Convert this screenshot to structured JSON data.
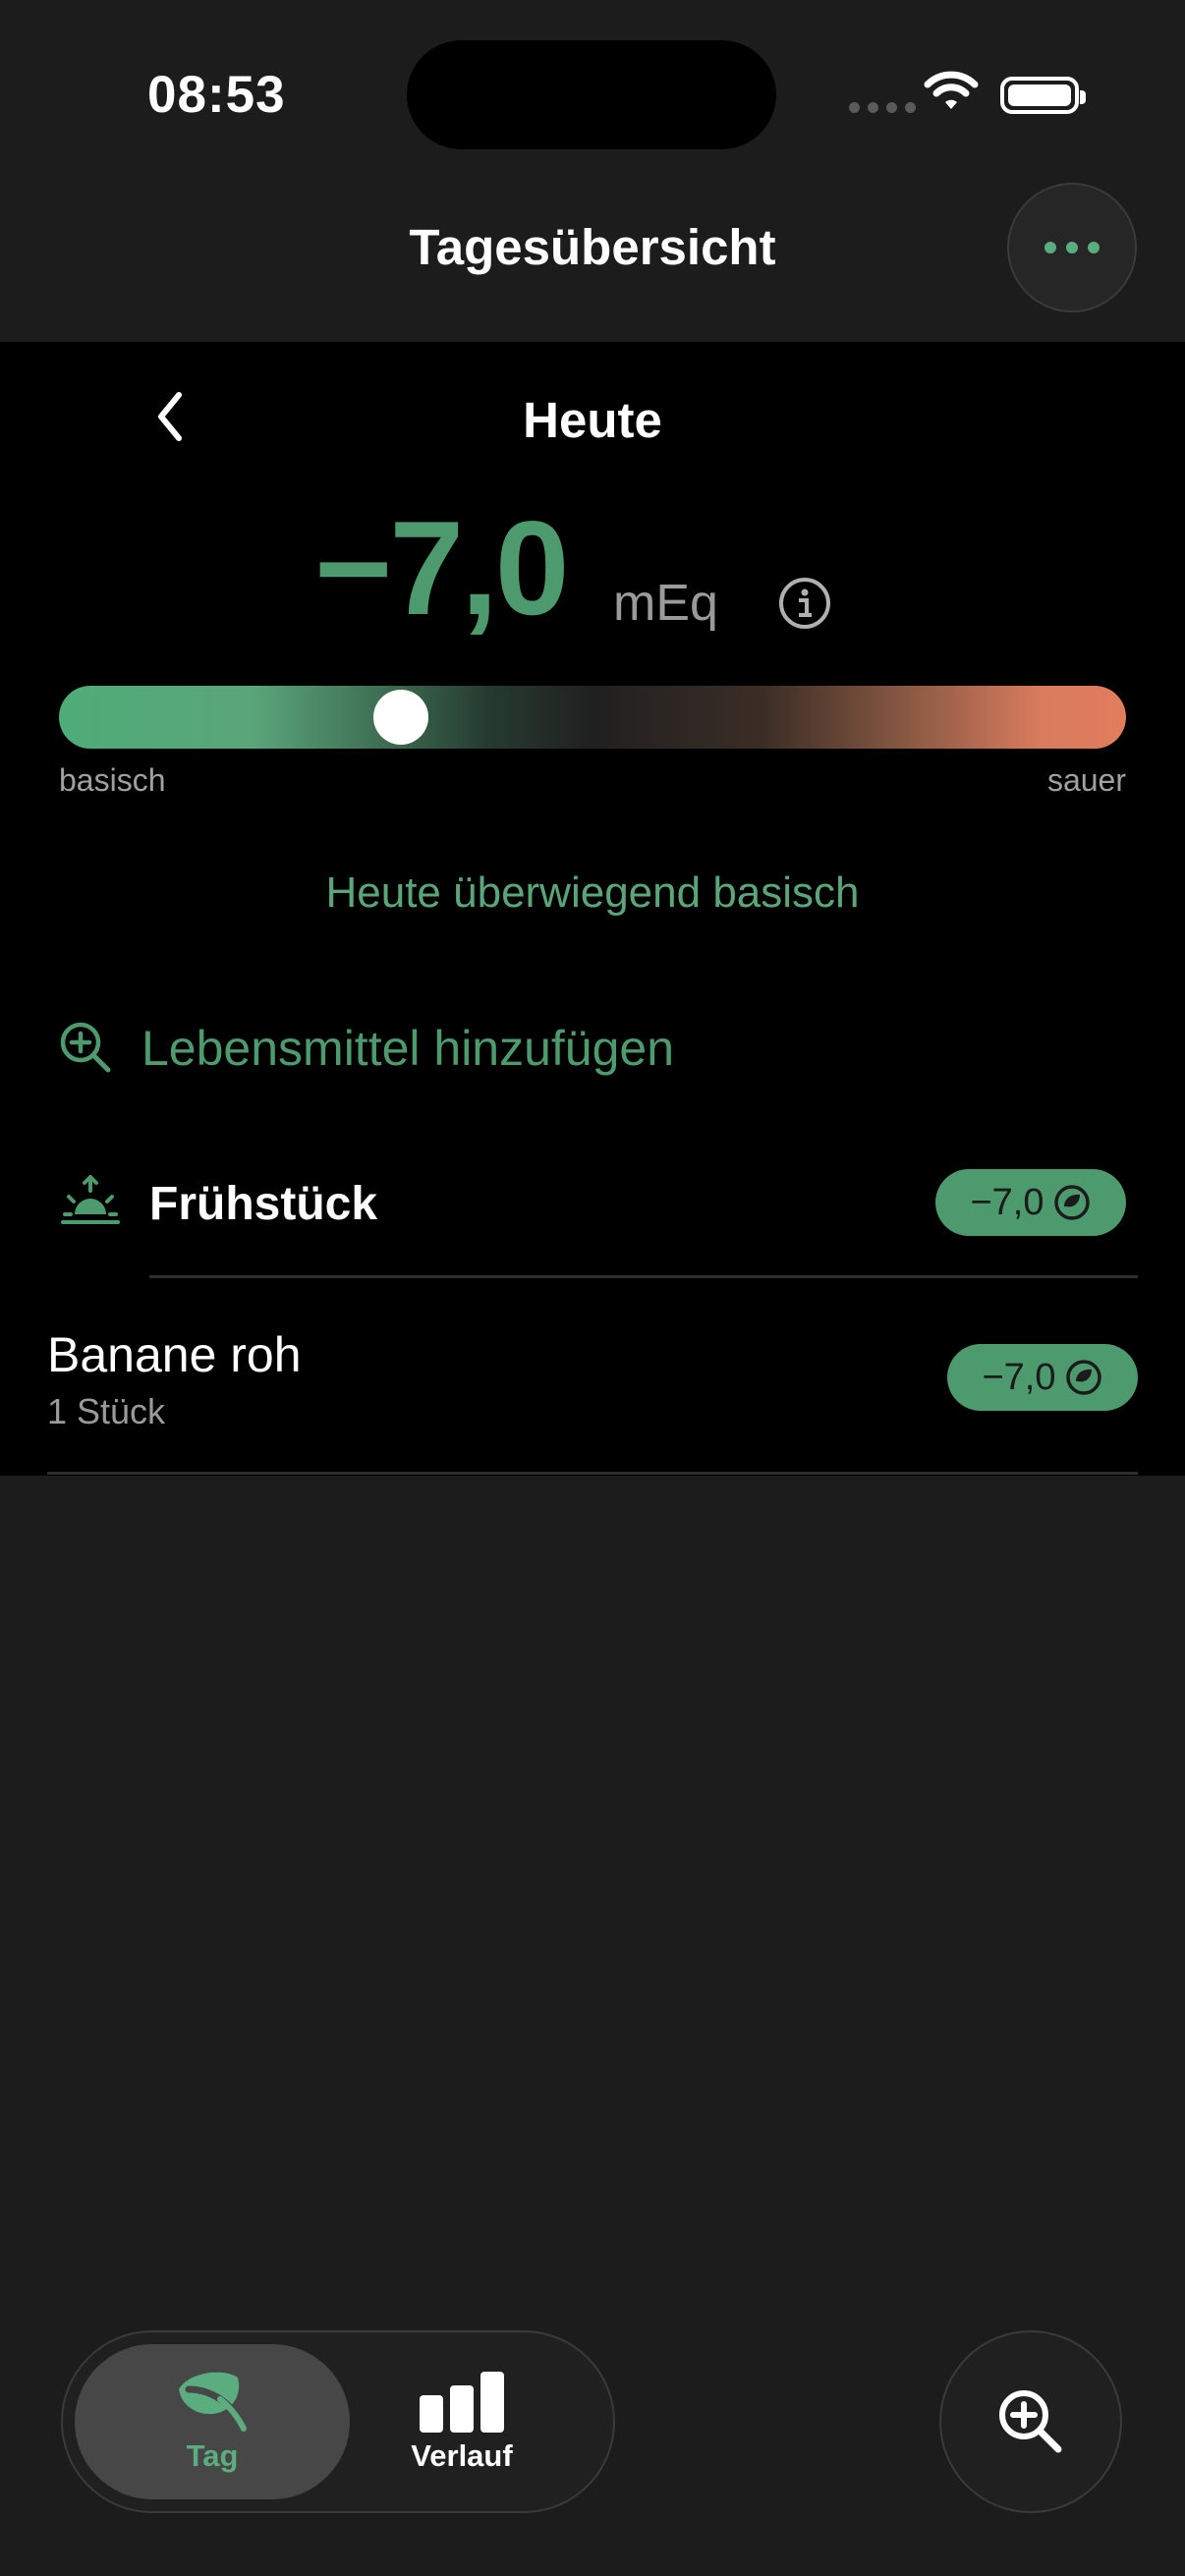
{
  "status_bar": {
    "time": "08:53"
  },
  "nav": {
    "title": "Tagesübersicht",
    "more_icon": "ellipsis-icon"
  },
  "day": {
    "title": "Heute",
    "score": "−7,0",
    "unit": "mEq",
    "gauge": {
      "left_label": "basisch",
      "right_label": "sauer",
      "position_fraction": 0.32
    },
    "summary": "Heute überwiegend basisch"
  },
  "add_food": {
    "label": "Lebensmittel hinzufügen"
  },
  "meals": [
    {
      "title": "Frühstück",
      "value": "−7,0",
      "items": [
        {
          "name": "Banane roh",
          "quantity": "1 Stück",
          "value": "−7,0"
        }
      ]
    }
  ],
  "tabbar": {
    "tabs": [
      {
        "label": "Tag",
        "icon": "leaf-icon",
        "active": true
      },
      {
        "label": "Verlauf",
        "icon": "bar-chart-icon",
        "active": false
      }
    ],
    "fab_icon": "search-plus-icon"
  },
  "colors": {
    "accent": "#4c9a6d",
    "acid": "#e07d5c",
    "background": "#1c1c1c"
  }
}
